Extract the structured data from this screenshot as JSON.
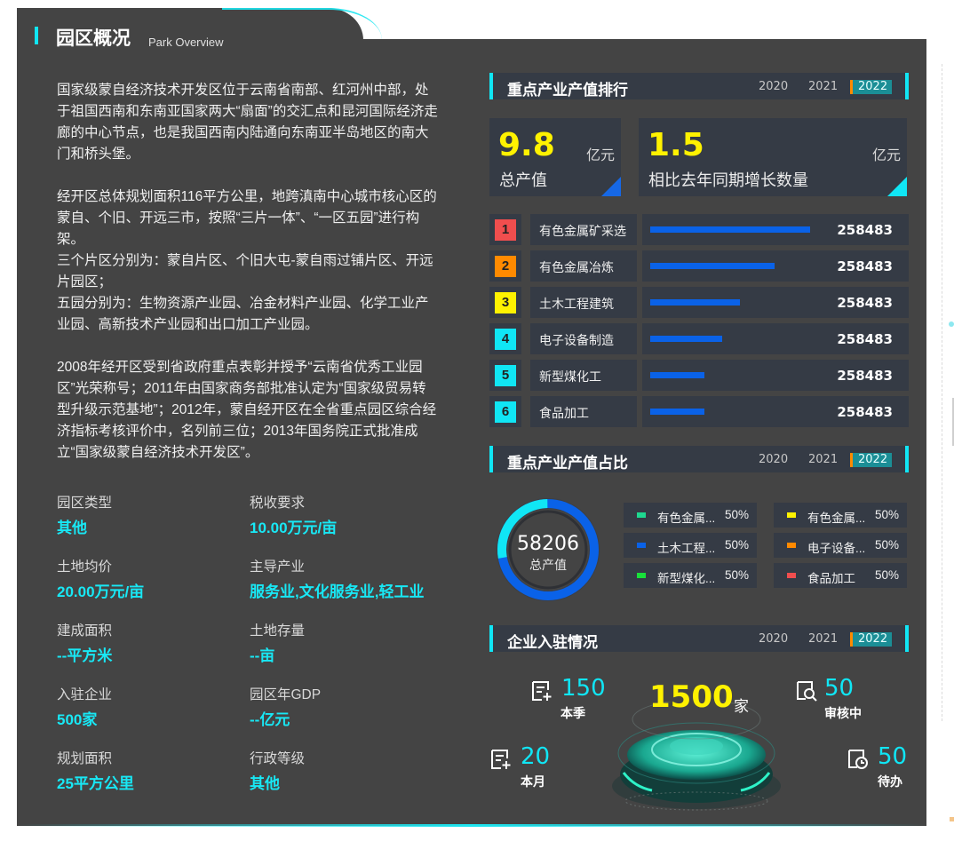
{
  "header": {
    "title": "园区概况",
    "subtitle": "Park Overview"
  },
  "intro": {
    "p1": "国家级蒙自经济技术开发区位于云南省南部、红河州中部，处于祖国西南和东南亚国家两大“扇面”的交汇点和昆河国际经济走廊的中心节点，也是我国西南内陆通向东南亚半岛地区的南大门和桥头堡。",
    "p2": "经开区总体规划面积116平方公里，地跨滇南中心城市核心区的蒙自、个旧、开远三市，按照“三片一体”、“一区五园”进行构架。",
    "p3": "三个片区分别为：蒙自片区、个旧大屯-蒙自雨过铺片区、开远片园区；",
    "p4": "五园分别为：生物资源产业园、冶金材料产业园、化学工业产业园、高新技术产业园和出口加工产业园。",
    "p5": "2008年经开区受到省政府重点表彰并授予“云南省优秀工业园区”光荣称号；2011年由国家商务部批准认定为“国家级贸易转型升级示范基地”；2012年，蒙自经开区在全省重点园区综合经济指标考核评价中，名列前三位；2013年国务院正式批准成立“国家级蒙自经济技术开发区”。"
  },
  "info": [
    {
      "label": "园区类型",
      "value": "其他"
    },
    {
      "label": "税收要求",
      "value": "10.00万元/亩"
    },
    {
      "label": "土地均价",
      "value": "20.00万元/亩"
    },
    {
      "label": "主导产业",
      "value": "服务业,文化服务业,轻工业"
    },
    {
      "label": "建成面积",
      "value": "--平方米"
    },
    {
      "label": "土地存量",
      "value": "--亩"
    },
    {
      "label": "入驻企业",
      "value": "500家"
    },
    {
      "label": "园区年GDP",
      "value": "--亿元"
    },
    {
      "label": "规划面积",
      "value": "25平方公里"
    },
    {
      "label": "行政等级",
      "value": "其他"
    }
  ],
  "years": [
    "2020",
    "2021",
    "2022"
  ],
  "ranking": {
    "title": "重点产业产值排行",
    "kpi1": {
      "value": "9.8",
      "unit": "亿元",
      "label": "总产值"
    },
    "kpi2": {
      "value": "1.5",
      "unit": "亿元",
      "label": "相比去年同期增长数量"
    },
    "items": [
      {
        "rank": "1",
        "name": "有色金属矿采选",
        "value": "258483",
        "fill": 1.0,
        "color": "#f04e4e"
      },
      {
        "rank": "2",
        "name": "有色金属冶炼",
        "value": "258483",
        "fill": 0.78,
        "color": "#ff8a00"
      },
      {
        "rank": "3",
        "name": "土木工程建筑",
        "value": "258483",
        "fill": 0.56,
        "color": "#fff200"
      },
      {
        "rank": "4",
        "name": "电子设备制造",
        "value": "258483",
        "fill": 0.45,
        "color": "#10e6f5"
      },
      {
        "rank": "5",
        "name": "新型煤化工",
        "value": "258483",
        "fill": 0.34,
        "color": "#10e6f5"
      },
      {
        "rank": "6",
        "name": "食品加工",
        "value": "258483",
        "fill": 0.34,
        "color": "#10e6f5"
      }
    ]
  },
  "share": {
    "title": "重点产业产值占比",
    "total": "58206",
    "total_label": "总产值",
    "legend": [
      {
        "name": "有色金属...",
        "pct": "50%",
        "color": "#1ed890"
      },
      {
        "name": "有色金属...",
        "pct": "50%",
        "color": "#fff200"
      },
      {
        "name": "土木工程...",
        "pct": "50%",
        "color": "#0a62e8"
      },
      {
        "name": "电子设备...",
        "pct": "50%",
        "color": "#ff8a00"
      },
      {
        "name": "新型煤化...",
        "pct": "50%",
        "color": "#18e03a"
      },
      {
        "name": "食品加工",
        "pct": "50%",
        "color": "#f04e4e"
      }
    ]
  },
  "enterprise": {
    "title": "企业入驻情况",
    "total": "1500",
    "total_unit": "家",
    "season": {
      "value": "150",
      "label": "本季"
    },
    "review": {
      "value": "50",
      "label": "审核中"
    },
    "month": {
      "value": "20",
      "label": "本月"
    },
    "pending": {
      "value": "50",
      "label": "待办"
    }
  }
}
